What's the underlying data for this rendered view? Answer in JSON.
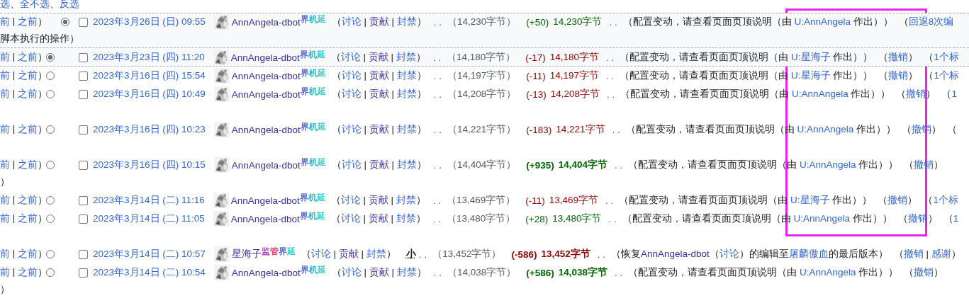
{
  "select_links": [
    {
      "text": "选",
      "kind": "link"
    },
    {
      "text": "、",
      "kind": "text"
    },
    {
      "text": "全不选",
      "kind": "link"
    },
    {
      "text": "、",
      "kind": "text"
    },
    {
      "text": "反选",
      "kind": "link"
    }
  ],
  "rows": [
    {
      "nav": [
        {
          "text": "前",
          "kind": "link"
        },
        {
          "text": " | ",
          "kind": "text"
        },
        {
          "text": "之前",
          "kind": "link"
        },
        {
          "text": "）",
          "kind": "text"
        }
      ],
      "radio": {
        "kind": "newer",
        "selected": true
      },
      "checked": false,
      "date": "2023年3月26日 (日) 09:55",
      "user": {
        "name": "AnnAngela-dbot",
        "tags": [
          {
            "text": "界",
            "color": "#5a6fd6"
          },
          {
            "text": "机",
            "color": "#2bb5c4"
          },
          {
            "text": "延",
            "color": "#33cccc"
          }
        ]
      },
      "items": [
        {
          "kind": "runs",
          "parts": [
            {
              "text": "（",
              "kind": "text"
            },
            {
              "text": "讨论",
              "kind": "link"
            },
            {
              "text": " | ",
              "kind": "text"
            },
            {
              "text": "贡献",
              "kind": "visited"
            },
            {
              "text": " | ",
              "kind": "text"
            },
            {
              "text": "封禁",
              "kind": "link"
            },
            {
              "text": "）",
              "kind": "text"
            }
          ]
        },
        {
          "kind": "sep",
          "text": ". ."
        },
        {
          "kind": "size",
          "text": "（14,230字节）"
        },
        {
          "kind": "diff",
          "text": "(+50)",
          "positive": true,
          "large": false
        },
        {
          "kind": "newsize",
          "text": "14,230字节",
          "positive": true,
          "large": false
        },
        {
          "kind": "sep",
          "text": ". ."
        },
        {
          "kind": "summary",
          "parts": [
            {
              "text": "（配置变动，请查看页面页顶说明（由 ",
              "kind": "text"
            },
            {
              "text": "U:AnnAngela",
              "kind": "link"
            },
            {
              "text": " 作出））",
              "kind": "text"
            }
          ]
        },
        {
          "kind": "runs",
          "parts": [
            {
              "text": "（",
              "kind": "text"
            },
            {
              "text": "回退8次编",
              "kind": "link"
            }
          ]
        }
      ],
      "tail": "脚本执行的操作）",
      "extra_line": false
    },
    {
      "nav": [
        {
          "text": "前",
          "kind": "link"
        },
        {
          "text": " | ",
          "kind": "text"
        },
        {
          "text": "之前",
          "kind": "link"
        },
        {
          "text": "）",
          "kind": "text"
        }
      ],
      "radio": {
        "kind": "older",
        "selected": true
      },
      "checked": false,
      "date": "2023年3月23日 (四) 11:20",
      "user": {
        "name": "AnnAngela-dbot",
        "tags": [
          {
            "text": "界",
            "color": "#5a6fd6"
          },
          {
            "text": "机",
            "color": "#2bb5c4"
          },
          {
            "text": "延",
            "color": "#33cccc"
          }
        ]
      },
      "items": [
        {
          "kind": "runs",
          "parts": [
            {
              "text": "（",
              "kind": "text"
            },
            {
              "text": "讨论",
              "kind": "link"
            },
            {
              "text": " | ",
              "kind": "text"
            },
            {
              "text": "贡献",
              "kind": "visited"
            },
            {
              "text": " | ",
              "kind": "text"
            },
            {
              "text": "封禁",
              "kind": "link"
            },
            {
              "text": "）",
              "kind": "text"
            }
          ]
        },
        {
          "kind": "sep",
          "text": ". ."
        },
        {
          "kind": "size",
          "text": "（14,180字节）"
        },
        {
          "kind": "diff",
          "text": "(-17)",
          "positive": false,
          "large": false
        },
        {
          "kind": "newsize",
          "text": "14,180字节",
          "positive": false,
          "large": false
        },
        {
          "kind": "sep",
          "text": ". ."
        },
        {
          "kind": "summary",
          "parts": [
            {
              "text": "（配置变动，请查看页面页顶说明（由 ",
              "kind": "text"
            },
            {
              "text": "U:星海子",
              "kind": "link"
            },
            {
              "text": " 作出））",
              "kind": "text"
            }
          ]
        },
        {
          "kind": "runs",
          "parts": [
            {
              "text": "（",
              "kind": "text"
            },
            {
              "text": "撤销",
              "kind": "link"
            },
            {
              "text": "）",
              "kind": "text"
            }
          ]
        },
        {
          "kind": "runs",
          "parts": [
            {
              "text": "（",
              "kind": "text"
            },
            {
              "text": "1个标",
              "kind": "link"
            }
          ]
        }
      ],
      "extra_line": false
    },
    {
      "nav": [
        {
          "text": "前",
          "kind": "link"
        },
        {
          "text": " | ",
          "kind": "text"
        },
        {
          "text": "之前",
          "kind": "link"
        },
        {
          "text": "）",
          "kind": "text"
        }
      ],
      "radio": {
        "kind": "older",
        "selected": false
      },
      "checked": false,
      "date": "2023年3月16日 (四) 15:54",
      "user": {
        "name": "AnnAngela-dbot",
        "tags": [
          {
            "text": "界",
            "color": "#5a6fd6"
          },
          {
            "text": "机",
            "color": "#2bb5c4"
          },
          {
            "text": "延",
            "color": "#33cccc"
          }
        ]
      },
      "items": [
        {
          "kind": "runs",
          "parts": [
            {
              "text": "（",
              "kind": "text"
            },
            {
              "text": "讨论",
              "kind": "link"
            },
            {
              "text": " | ",
              "kind": "text"
            },
            {
              "text": "贡献",
              "kind": "visited"
            },
            {
              "text": " | ",
              "kind": "text"
            },
            {
              "text": "封禁",
              "kind": "link"
            },
            {
              "text": "）",
              "kind": "text"
            }
          ]
        },
        {
          "kind": "sep",
          "text": ". ."
        },
        {
          "kind": "size",
          "text": "（14,197字节）"
        },
        {
          "kind": "diff",
          "text": "(-11)",
          "positive": false,
          "large": false
        },
        {
          "kind": "newsize",
          "text": "14,197字节",
          "positive": false,
          "large": false
        },
        {
          "kind": "sep",
          "text": ". ."
        },
        {
          "kind": "summary",
          "parts": [
            {
              "text": "（配置变动，请查看页面页顶说明（由 ",
              "kind": "text"
            },
            {
              "text": "U:星海子",
              "kind": "link"
            },
            {
              "text": " 作出））",
              "kind": "text"
            }
          ]
        },
        {
          "kind": "runs",
          "parts": [
            {
              "text": "（",
              "kind": "text"
            },
            {
              "text": "撤销",
              "kind": "link"
            },
            {
              "text": "）",
              "kind": "text"
            }
          ]
        },
        {
          "kind": "runs",
          "parts": [
            {
              "text": "（",
              "kind": "text"
            },
            {
              "text": "1个标",
              "kind": "link"
            }
          ]
        }
      ],
      "extra_line": false
    },
    {
      "nav": [
        {
          "text": "前",
          "kind": "link"
        },
        {
          "text": " | ",
          "kind": "text"
        },
        {
          "text": "之前",
          "kind": "link"
        },
        {
          "text": "）",
          "kind": "text"
        }
      ],
      "radio": {
        "kind": "older",
        "selected": false
      },
      "checked": false,
      "date": "2023年3月16日 (四) 10:49",
      "user": {
        "name": "AnnAngela-dbot",
        "tags": [
          {
            "text": "界",
            "color": "#5a6fd6"
          },
          {
            "text": "机",
            "color": "#2bb5c4"
          },
          {
            "text": "延",
            "color": "#33cccc"
          }
        ]
      },
      "items": [
        {
          "kind": "runs",
          "parts": [
            {
              "text": "（",
              "kind": "text"
            },
            {
              "text": "讨论",
              "kind": "link"
            },
            {
              "text": " | ",
              "kind": "text"
            },
            {
              "text": "贡献",
              "kind": "visited"
            },
            {
              "text": " | ",
              "kind": "text"
            },
            {
              "text": "封禁",
              "kind": "link"
            },
            {
              "text": "）",
              "kind": "text"
            }
          ]
        },
        {
          "kind": "sep",
          "text": ". ."
        },
        {
          "kind": "size",
          "text": "（14,208字节）"
        },
        {
          "kind": "diff",
          "text": "(-13)",
          "positive": false,
          "large": false
        },
        {
          "kind": "newsize",
          "text": "14,208字节",
          "positive": false,
          "large": false
        },
        {
          "kind": "sep",
          "text": ". ."
        },
        {
          "kind": "summary",
          "parts": [
            {
              "text": "（配置变动，请查看页面页顶说明（由 ",
              "kind": "text"
            },
            {
              "text": "U:AnnAngela",
              "kind": "link"
            },
            {
              "text": " 作出））",
              "kind": "text"
            }
          ]
        },
        {
          "kind": "runs",
          "parts": [
            {
              "text": "（",
              "kind": "text"
            },
            {
              "text": "撤销",
              "kind": "link"
            },
            {
              "text": "）",
              "kind": "text"
            }
          ]
        },
        {
          "kind": "runs",
          "parts": [
            {
              "text": "（",
              "kind": "text"
            },
            {
              "text": "1",
              "kind": "link"
            }
          ]
        }
      ],
      "extra_line": true
    },
    {
      "nav": [
        {
          "text": "前",
          "kind": "link"
        },
        {
          "text": " | ",
          "kind": "text"
        },
        {
          "text": "之前",
          "kind": "link"
        },
        {
          "text": "）",
          "kind": "text"
        }
      ],
      "radio": {
        "kind": "older",
        "selected": false
      },
      "checked": false,
      "date": "2023年3月16日 (四) 10:23",
      "user": {
        "name": "AnnAngela-dbot",
        "tags": [
          {
            "text": "界",
            "color": "#5a6fd6"
          },
          {
            "text": "机",
            "color": "#2bb5c4"
          },
          {
            "text": "延",
            "color": "#33cccc"
          }
        ]
      },
      "items": [
        {
          "kind": "runs",
          "parts": [
            {
              "text": "（",
              "kind": "text"
            },
            {
              "text": "讨论",
              "kind": "link"
            },
            {
              "text": " | ",
              "kind": "text"
            },
            {
              "text": "贡献",
              "kind": "visited"
            },
            {
              "text": " | ",
              "kind": "text"
            },
            {
              "text": "封禁",
              "kind": "link"
            },
            {
              "text": "）",
              "kind": "text"
            }
          ]
        },
        {
          "kind": "sep",
          "text": ". ."
        },
        {
          "kind": "size",
          "text": "（14,221字节）"
        },
        {
          "kind": "diff",
          "text": "(-183)",
          "positive": false,
          "large": false
        },
        {
          "kind": "newsize",
          "text": "14,221字节",
          "positive": false,
          "large": false
        },
        {
          "kind": "sep",
          "text": ". ."
        },
        {
          "kind": "summary",
          "parts": [
            {
              "text": "（配置变动，请查看页面页顶说明（由 ",
              "kind": "text"
            },
            {
              "text": "U:AnnAngela",
              "kind": "link"
            },
            {
              "text": " 作出））",
              "kind": "text"
            }
          ]
        },
        {
          "kind": "runs",
          "parts": [
            {
              "text": "（",
              "kind": "text"
            },
            {
              "text": "撤销",
              "kind": "link"
            },
            {
              "text": "）",
              "kind": "text"
            }
          ]
        },
        {
          "kind": "runs",
          "parts": [
            {
              "text": "（",
              "kind": "text"
            }
          ]
        }
      ],
      "extra_line": true
    },
    {
      "nav": [
        {
          "text": "前",
          "kind": "link"
        },
        {
          "text": " | ",
          "kind": "text"
        },
        {
          "text": "之前",
          "kind": "link"
        },
        {
          "text": "）",
          "kind": "text"
        }
      ],
      "radio": {
        "kind": "older",
        "selected": false
      },
      "checked": false,
      "date": "2023年3月16日 (四) 10:15",
      "user": {
        "name": "AnnAngela-dbot",
        "tags": [
          {
            "text": "界",
            "color": "#5a6fd6"
          },
          {
            "text": "机",
            "color": "#2bb5c4"
          },
          {
            "text": "延",
            "color": "#33cccc"
          }
        ]
      },
      "items": [
        {
          "kind": "runs",
          "parts": [
            {
              "text": "（",
              "kind": "text"
            },
            {
              "text": "讨论",
              "kind": "link"
            },
            {
              "text": " | ",
              "kind": "text"
            },
            {
              "text": "贡献",
              "kind": "visited"
            },
            {
              "text": " | ",
              "kind": "text"
            },
            {
              "text": "封禁",
              "kind": "link"
            },
            {
              "text": "）",
              "kind": "text"
            }
          ]
        },
        {
          "kind": "sep",
          "text": ". ."
        },
        {
          "kind": "size",
          "text": "（14,404字节）"
        },
        {
          "kind": "diff",
          "text": "(+935)",
          "positive": true,
          "large": true
        },
        {
          "kind": "newsize",
          "text": "14,404字节",
          "positive": true,
          "large": true
        },
        {
          "kind": "sep",
          "text": ". ."
        },
        {
          "kind": "summary",
          "parts": [
            {
              "text": "（配置变动，请查看页面页顶说明（由 ",
              "kind": "text"
            },
            {
              "text": "U:AnnAngela",
              "kind": "link"
            },
            {
              "text": " 作出））",
              "kind": "text"
            }
          ]
        },
        {
          "kind": "runs",
          "parts": [
            {
              "text": "（",
              "kind": "text"
            },
            {
              "text": "撤销",
              "kind": "link"
            },
            {
              "text": "）",
              "kind": "text"
            }
          ]
        }
      ],
      "tail": "）",
      "extra_line": false
    },
    {
      "nav": [
        {
          "text": "前",
          "kind": "link"
        },
        {
          "text": " | ",
          "kind": "text"
        },
        {
          "text": "之前",
          "kind": "link"
        },
        {
          "text": "）",
          "kind": "text"
        }
      ],
      "radio": {
        "kind": "older",
        "selected": false
      },
      "checked": false,
      "date": "2023年3月14日 (二) 11:16",
      "user": {
        "name": "AnnAngela-dbot",
        "tags": [
          {
            "text": "界",
            "color": "#5a6fd6"
          },
          {
            "text": "机",
            "color": "#2bb5c4"
          },
          {
            "text": "延",
            "color": "#33cccc"
          }
        ]
      },
      "items": [
        {
          "kind": "runs",
          "parts": [
            {
              "text": "（",
              "kind": "text"
            },
            {
              "text": "讨论",
              "kind": "link"
            },
            {
              "text": " | ",
              "kind": "text"
            },
            {
              "text": "贡献",
              "kind": "visited"
            },
            {
              "text": " | ",
              "kind": "text"
            },
            {
              "text": "封禁",
              "kind": "link"
            },
            {
              "text": "）",
              "kind": "text"
            }
          ]
        },
        {
          "kind": "sep",
          "text": ". ."
        },
        {
          "kind": "size",
          "text": "（13,469字节）"
        },
        {
          "kind": "diff",
          "text": "(-11)",
          "positive": false,
          "large": false
        },
        {
          "kind": "newsize",
          "text": "13,469字节",
          "positive": false,
          "large": false
        },
        {
          "kind": "sep",
          "text": ". ."
        },
        {
          "kind": "summary",
          "parts": [
            {
              "text": "（配置变动，请查看页面页顶说明（由 ",
              "kind": "text"
            },
            {
              "text": "U:星海子",
              "kind": "link"
            },
            {
              "text": " 作出））",
              "kind": "text"
            }
          ]
        },
        {
          "kind": "runs",
          "parts": [
            {
              "text": "（",
              "kind": "text"
            },
            {
              "text": "撤销",
              "kind": "link"
            },
            {
              "text": "）",
              "kind": "text"
            }
          ]
        },
        {
          "kind": "runs",
          "parts": [
            {
              "text": "（",
              "kind": "text"
            },
            {
              "text": "1个标",
              "kind": "link"
            }
          ]
        }
      ],
      "extra_line": false
    },
    {
      "nav": [
        {
          "text": "前",
          "kind": "link"
        },
        {
          "text": " | ",
          "kind": "text"
        },
        {
          "text": "之前",
          "kind": "link"
        },
        {
          "text": "）",
          "kind": "text"
        }
      ],
      "radio": {
        "kind": "older",
        "selected": false
      },
      "checked": false,
      "date": "2023年3月14日 (二) 11:05",
      "user": {
        "name": "AnnAngela-dbot",
        "tags": [
          {
            "text": "界",
            "color": "#5a6fd6"
          },
          {
            "text": "机",
            "color": "#2bb5c4"
          },
          {
            "text": "延",
            "color": "#33cccc"
          }
        ]
      },
      "items": [
        {
          "kind": "runs",
          "parts": [
            {
              "text": "（",
              "kind": "text"
            },
            {
              "text": "讨论",
              "kind": "link"
            },
            {
              "text": " | ",
              "kind": "text"
            },
            {
              "text": "贡献",
              "kind": "visited"
            },
            {
              "text": " | ",
              "kind": "text"
            },
            {
              "text": "封禁",
              "kind": "link"
            },
            {
              "text": "）",
              "kind": "text"
            }
          ]
        },
        {
          "kind": "sep",
          "text": ". ."
        },
        {
          "kind": "size",
          "text": "（13,480字节）"
        },
        {
          "kind": "diff",
          "text": "(+28)",
          "positive": true,
          "large": false
        },
        {
          "kind": "newsize",
          "text": "13,480字节",
          "positive": true,
          "large": false
        },
        {
          "kind": "sep",
          "text": ". ."
        },
        {
          "kind": "summary",
          "parts": [
            {
              "text": "（配置变动，请查看页面页顶说明（由 ",
              "kind": "text"
            },
            {
              "text": "U:AnnAngela",
              "kind": "link"
            },
            {
              "text": " 作出））",
              "kind": "text"
            }
          ]
        },
        {
          "kind": "runs",
          "parts": [
            {
              "text": "（",
              "kind": "text"
            },
            {
              "text": "撤销",
              "kind": "link"
            },
            {
              "text": "）",
              "kind": "text"
            }
          ]
        },
        {
          "kind": "runs",
          "parts": [
            {
              "text": "（",
              "kind": "text"
            },
            {
              "text": "1",
              "kind": "link"
            }
          ]
        }
      ],
      "extra_line": true
    },
    {
      "nav": [
        {
          "text": "前",
          "kind": "link"
        },
        {
          "text": " | ",
          "kind": "text"
        },
        {
          "text": "之前",
          "kind": "link"
        },
        {
          "text": "）",
          "kind": "text"
        }
      ],
      "radio": {
        "kind": "older",
        "selected": false
      },
      "checked": false,
      "date": "2023年3月14日 (二) 10:57",
      "user": {
        "name": "星海子",
        "tags": [
          {
            "text": "监",
            "color": "#b23fd0"
          },
          {
            "text": "管",
            "color": "#e0457b"
          },
          {
            "text": "界",
            "color": "#5a6fd6"
          },
          {
            "text": "延",
            "color": "#33cccc"
          }
        ]
      },
      "items": [
        {
          "kind": "runs",
          "parts": [
            {
              "text": "（",
              "kind": "text"
            },
            {
              "text": "讨论",
              "kind": "link"
            },
            {
              "text": " | ",
              "kind": "text"
            },
            {
              "text": "贡献",
              "kind": "visited"
            },
            {
              "text": " | ",
              "kind": "text"
            },
            {
              "text": "封禁",
              "kind": "link"
            },
            {
              "text": "）",
              "kind": "text"
            }
          ]
        },
        {
          "kind": "minor",
          "text": "小"
        },
        {
          "kind": "sep",
          "text": ". ."
        },
        {
          "kind": "size",
          "text": "（13,452字节）"
        },
        {
          "kind": "diff",
          "text": "(-586)",
          "positive": false,
          "large": true
        },
        {
          "kind": "newsize",
          "text": "13,452字节",
          "positive": false,
          "large": true
        },
        {
          "kind": "sep",
          "text": ". ."
        },
        {
          "kind": "summary",
          "parts": [
            {
              "text": "（恢复",
              "kind": "text"
            },
            {
              "text": "AnnAngela-dbot",
              "kind": "visited"
            },
            {
              "text": "（",
              "kind": "text"
            },
            {
              "text": "讨论",
              "kind": "link"
            },
            {
              "text": "）的编辑至",
              "kind": "text"
            },
            {
              "text": "屠麟傲血",
              "kind": "link"
            },
            {
              "text": "的最后版本）",
              "kind": "text"
            }
          ]
        },
        {
          "kind": "runs",
          "parts": [
            {
              "text": "（",
              "kind": "text"
            },
            {
              "text": "撤销",
              "kind": "link"
            },
            {
              "text": " | ",
              "kind": "text"
            },
            {
              "text": "感谢",
              "kind": "link"
            },
            {
              "text": "）",
              "kind": "text"
            }
          ]
        }
      ],
      "extra_line": false
    },
    {
      "nav": [
        {
          "text": "前",
          "kind": "link"
        },
        {
          "text": " | ",
          "kind": "text"
        },
        {
          "text": "之前",
          "kind": "link"
        },
        {
          "text": "）",
          "kind": "text"
        }
      ],
      "radio": {
        "kind": "older",
        "selected": false
      },
      "checked": false,
      "date": "2023年3月14日 (二) 10:54",
      "user": {
        "name": "AnnAngela-dbot",
        "tags": [
          {
            "text": "界",
            "color": "#5a6fd6"
          },
          {
            "text": "机",
            "color": "#2bb5c4"
          },
          {
            "text": "延",
            "color": "#33cccc"
          }
        ]
      },
      "items": [
        {
          "kind": "runs",
          "parts": [
            {
              "text": "（",
              "kind": "text"
            },
            {
              "text": "讨论",
              "kind": "link"
            },
            {
              "text": " | ",
              "kind": "text"
            },
            {
              "text": "贡献",
              "kind": "visited"
            },
            {
              "text": " | ",
              "kind": "text"
            },
            {
              "text": "封禁",
              "kind": "link"
            },
            {
              "text": "）",
              "kind": "text"
            }
          ]
        },
        {
          "kind": "sep",
          "text": ". ."
        },
        {
          "kind": "size",
          "text": "（14,038字节）"
        },
        {
          "kind": "diff",
          "text": "(+586)",
          "positive": true,
          "large": true
        },
        {
          "kind": "newsize",
          "text": "14,038字节",
          "positive": true,
          "large": true
        },
        {
          "kind": "sep",
          "text": ". ."
        },
        {
          "kind": "summary",
          "parts": [
            {
              "text": "（配置变动，请查看页面页顶说明（由 ",
              "kind": "text"
            },
            {
              "text": "U:AnnAngela",
              "kind": "link"
            },
            {
              "text": " 作出））",
              "kind": "text"
            }
          ]
        },
        {
          "kind": "runs",
          "parts": [
            {
              "text": "（",
              "kind": "text"
            },
            {
              "text": "撤销",
              "kind": "link"
            },
            {
              "text": "）",
              "kind": "text"
            }
          ]
        }
      ],
      "tail": "）",
      "extra_line": false
    }
  ]
}
